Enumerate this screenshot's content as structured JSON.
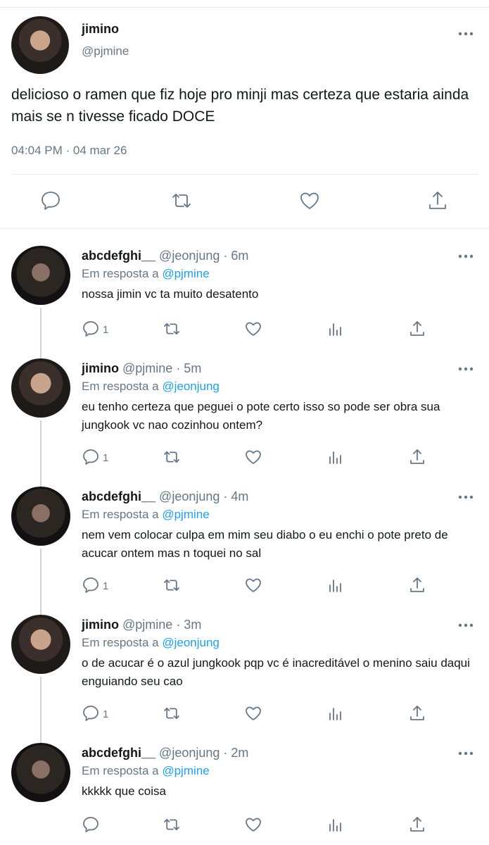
{
  "main_tweet": {
    "display_name": "jimino",
    "handle": "@pjmine",
    "text": "delicioso o ramen que fiz hoje pro minji mas certeza que estaria ainda mais se n tivesse ficado DOCE",
    "timestamp": "04:04 PM · 04 mar 26",
    "actions": [
      "comment-icon",
      "retweet-icon",
      "like-icon",
      "share-icon"
    ]
  },
  "reply_prefix": "Em resposta a",
  "replies": [
    {
      "display_name": "abcdefghi__",
      "meta": "@jeonjung · 6m",
      "reply_to": "@pjmine",
      "text": "nossa jimin vc ta muito desatento",
      "reply_count": "1",
      "avatar": "jk"
    },
    {
      "display_name": "jimino",
      "meta": "@pjmine · 5m",
      "reply_to": "@jeonjung",
      "text": "eu tenho certeza que peguei o pote certo isso so pode ser obra sua jungkook vc nao cozinhou ontem?",
      "reply_count": "1",
      "avatar": "jm"
    },
    {
      "display_name": "abcdefghi__",
      "meta": "@jeonjung · 4m",
      "reply_to": "@pjmine",
      "text": "nem vem colocar culpa em mim seu diabo o eu enchi o pote preto de acucar ontem mas n toquei no sal",
      "reply_count": "1",
      "avatar": "jk"
    },
    {
      "display_name": "jimino",
      "meta": "@pjmine · 3m",
      "reply_to": "@jeonjung",
      "text": "o de acucar é o azul jungkook pqp vc é inacreditável o menino saiu daqui enguiando seu cao",
      "reply_count": "1",
      "avatar": "jm"
    },
    {
      "display_name": "abcdefghi__",
      "meta": "@jeonjung · 2m",
      "reply_to": "@pjmine",
      "text": "kkkkk que coisa",
      "reply_count": "",
      "avatar": "jk"
    }
  ],
  "colors": {
    "text": "#14171a",
    "secondary": "#657786",
    "link": "#1da1f2",
    "divider": "#e6ecf0"
  }
}
